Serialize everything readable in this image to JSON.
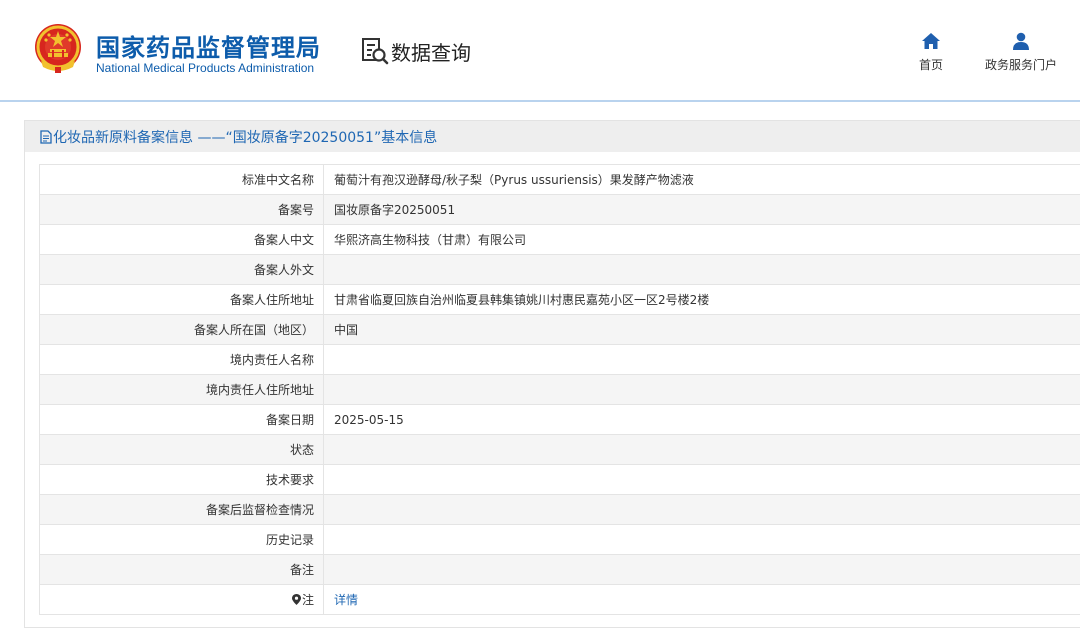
{
  "header": {
    "agency_cn": "国家药品监督管理局",
    "agency_en": "National Medical Products Administration",
    "section_title": "数据查询",
    "nav": [
      {
        "label": "首页",
        "icon": "home-icon"
      },
      {
        "label": "政务服务门户",
        "icon": "user-icon"
      }
    ]
  },
  "panel": {
    "title": "化妆品新原料备案信息 ——“国妆原备字20250051”基本信息",
    "rows": [
      {
        "label": "标准中文名称",
        "value": "葡萄汁有孢汉逊酵母/秋子梨（Pyrus ussuriensis）果发酵产物滤液"
      },
      {
        "label": "备案号",
        "value": "国妆原备字20250051"
      },
      {
        "label": "备案人中文",
        "value": "华熙济高生物科技（甘肃）有限公司"
      },
      {
        "label": "备案人外文",
        "value": ""
      },
      {
        "label": "备案人住所地址",
        "value": "甘肃省临夏回族自治州临夏县韩集镇姚川村惠民嘉苑小区一区2号楼2楼"
      },
      {
        "label": "备案人所在国（地区）",
        "value": "中国"
      },
      {
        "label": "境内责任人名称",
        "value": ""
      },
      {
        "label": "境内责任人住所地址",
        "value": ""
      },
      {
        "label": "备案日期",
        "value": "2025-05-15"
      },
      {
        "label": "状态",
        "value": ""
      },
      {
        "label": "技术要求",
        "value": ""
      },
      {
        "label": "备案后监督检查情况",
        "value": ""
      },
      {
        "label": "历史记录",
        "value": ""
      },
      {
        "label": "备注",
        "value": ""
      }
    ],
    "note_row": {
      "label": "注",
      "icon": "pin-icon",
      "link": "详情"
    }
  },
  "colors": {
    "brand_blue": "#0d5cab",
    "link_blue": "#1f67b3",
    "header_rule": "#b9d3ee",
    "emblem_red": "#d7261e",
    "emblem_gold": "#f2c12e"
  }
}
